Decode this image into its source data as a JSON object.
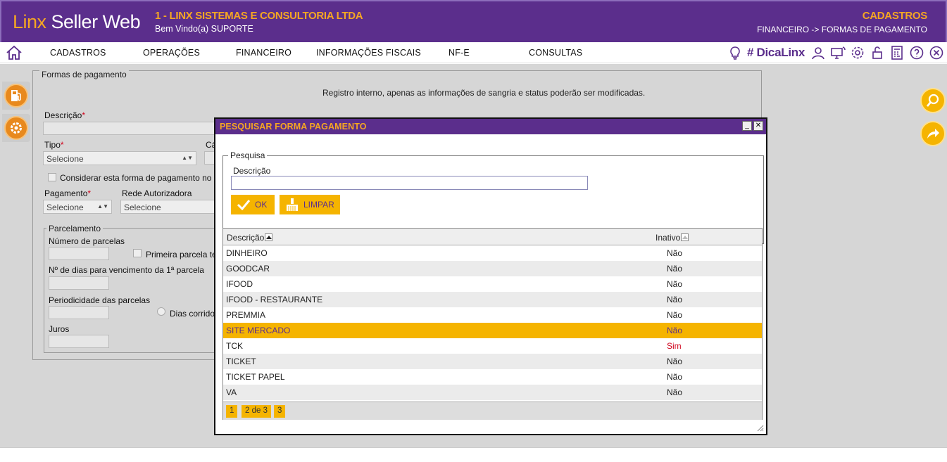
{
  "header": {
    "logo_linx": "Linx",
    "logo_rest": " Seller Web",
    "company": "1 - LINX SISTEMAS E CONSULTORIA LTDA",
    "welcome": "Bem Vindo(a) SUPORTE",
    "module": "CADASTROS",
    "breadcrumb": "FINANCEIRO -> FORMAS DE PAGAMENTO"
  },
  "menu": {
    "items": [
      "CADASTROS",
      "OPERAÇÕES",
      "FINANCEIRO",
      "INFORMAÇÕES FISCAIS",
      "NF-E",
      "CONSULTAS"
    ],
    "dicalinx": "# DicaLinx"
  },
  "form": {
    "legend": "Formas de pagamento",
    "note": "Registro interno, apenas as informações de sangria e status poderão ser modificadas.",
    "descricao_label": "Descrição",
    "tipo_label": "Tipo",
    "tipo_value": "Selecione",
    "ca_label": "Cá",
    "considerar_label": "Considerar esta forma de pagamento no av",
    "pagamento_label": "Pagamento",
    "pagamento_value": "Selecione",
    "rede_label": "Rede Autorizadora",
    "rede_value": "Selecione",
    "parcelamento_legend": "Parcelamento",
    "num_parcelas_label": "Número de parcelas",
    "primeira_parcela_label": "Primeira parcela te",
    "dias_venc_label": "Nº de dias para vencimento da 1ª parcela",
    "periodicidade_label": "Periodicidade das parcelas",
    "dias_corridos_label": "Dias corridos",
    "juros_label": "Juros"
  },
  "modal": {
    "title": "PESQUISAR FORMA PAGAMENTO",
    "minimize": "_",
    "close": "✕",
    "search_legend": "Pesquisa",
    "search_label": "Descrição",
    "search_value": "",
    "ok_label": "OK",
    "limpar_label": "LIMPAR",
    "col_descricao": "Descrição",
    "col_inativo": "Inativo",
    "rows": [
      {
        "descricao": "DINHEIRO",
        "inativo": "Não"
      },
      {
        "descricao": "GOODCAR",
        "inativo": "Não"
      },
      {
        "descricao": "IFOOD",
        "inativo": "Não"
      },
      {
        "descricao": "IFOOD - RESTAURANTE",
        "inativo": "Não"
      },
      {
        "descricao": "PREMMIA",
        "inativo": "Não"
      },
      {
        "descricao": "SITE MERCADO",
        "inativo": "Não"
      },
      {
        "descricao": "TCK",
        "inativo": "Sim"
      },
      {
        "descricao": "TICKET",
        "inativo": "Não"
      },
      {
        "descricao": "TICKET PAPEL",
        "inativo": "Não"
      },
      {
        "descricao": "VA",
        "inativo": "Não"
      }
    ],
    "pages": [
      "1",
      "2 de 3",
      "3"
    ]
  },
  "colors": {
    "brand_purple": "#5b2e8c",
    "accent_orange": "#f5a623",
    "selection_yellow": "#f5b400"
  }
}
